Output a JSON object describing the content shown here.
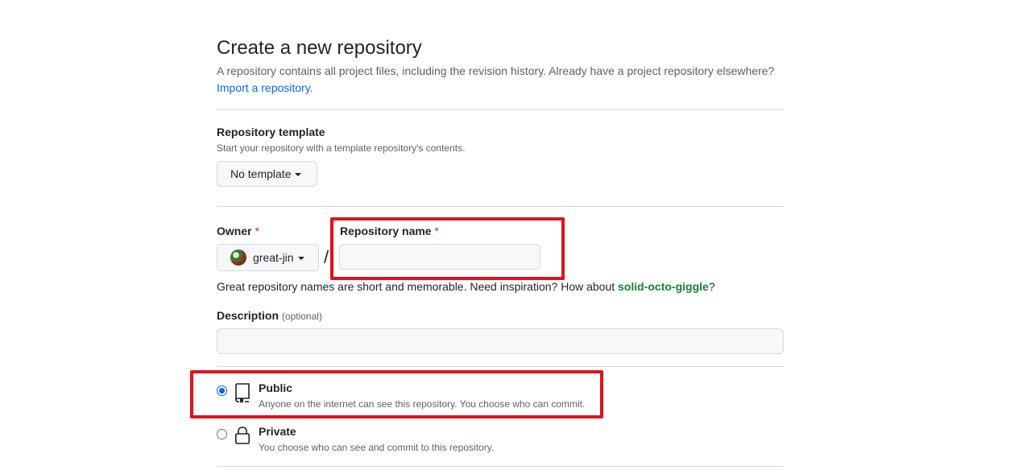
{
  "header": {
    "title": "Create a new repository",
    "subtitle": "A repository contains all project files, including the revision history. Already have a project repository elsewhere?",
    "import_link": "Import a repository."
  },
  "template": {
    "label": "Repository template",
    "note": "Start your repository with a template repository's contents.",
    "button_label": "No template"
  },
  "owner": {
    "label": "Owner",
    "required_mark": "*",
    "value": "great-jin"
  },
  "repo_name": {
    "label": "Repository name",
    "required_mark": "*",
    "value": "",
    "separator": "/"
  },
  "suggestion": {
    "text": "Great repository names are short and memorable. Need inspiration? How about",
    "name": "solid-octo-giggle",
    "end": "?"
  },
  "description": {
    "label": "Description",
    "optional": "(optional)",
    "value": ""
  },
  "visibility": {
    "selected": "public",
    "options": [
      {
        "title": "Public",
        "desc": "Anyone on the internet can see this repository. You choose who can commit.",
        "icon": "repo-icon"
      },
      {
        "title": "Private",
        "desc": "You choose who can see and commit to this repository.",
        "icon": "lock-icon"
      }
    ]
  },
  "colors": {
    "highlight": "#e0121b",
    "accent": "#0969da",
    "suggestion": "#1a7f37"
  }
}
